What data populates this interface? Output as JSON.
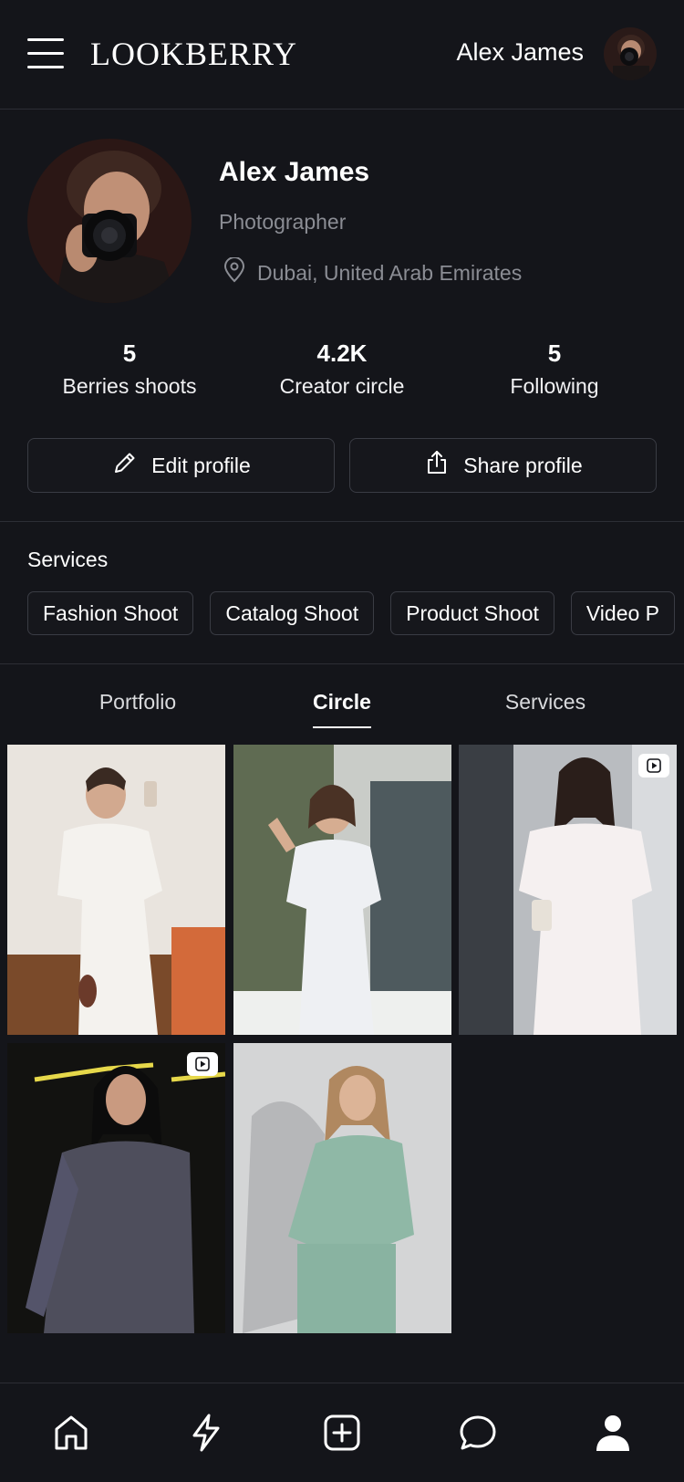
{
  "header": {
    "logo": "LOOKBERRY",
    "user_name": "Alex James"
  },
  "profile": {
    "name": "Alex James",
    "role": "Photographer",
    "location": "Dubai, United Arab Emirates"
  },
  "stats": [
    {
      "value": "5",
      "label": "Berries shoots"
    },
    {
      "value": "4.2K",
      "label": "Creator circle"
    },
    {
      "value": "5",
      "label": "Following"
    }
  ],
  "actions": {
    "edit_label": "Edit profile",
    "share_label": "Share profile"
  },
  "services": {
    "title": "Services",
    "chips": [
      "Fashion Shoot",
      "Catalog Shoot",
      "Product Shoot",
      "Video P"
    ]
  },
  "tabs": [
    {
      "label": "Portfolio",
      "active": false
    },
    {
      "label": "Circle",
      "active": true
    },
    {
      "label": "Services",
      "active": false
    }
  ],
  "grid": [
    {
      "kind": "photo",
      "video": false
    },
    {
      "kind": "photo",
      "video": false
    },
    {
      "kind": "photo",
      "video": true
    },
    {
      "kind": "photo",
      "video": true
    },
    {
      "kind": "photo",
      "video": false
    }
  ],
  "bottom_nav": [
    {
      "icon": "home-icon"
    },
    {
      "icon": "lightning-icon"
    },
    {
      "icon": "add-square-icon"
    },
    {
      "icon": "chat-bubble-icon"
    },
    {
      "icon": "profile-icon",
      "active": true
    }
  ],
  "colors": {
    "background": "#14151a",
    "muted_text": "#8b8d94",
    "border": "#3a3c44"
  }
}
